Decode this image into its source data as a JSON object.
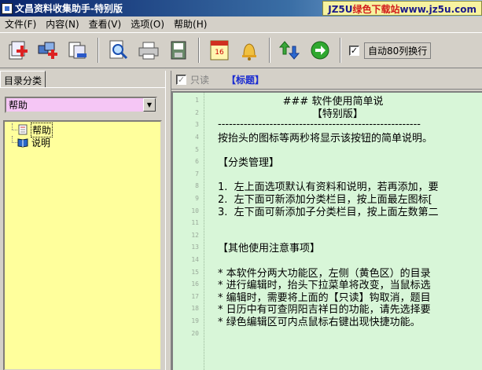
{
  "window": {
    "title": "文昌资料收集助手-特别版"
  },
  "watermark": {
    "prefix": "JZ5U",
    "accent": "绿色下载站",
    "suffix": "www.jz5u.com"
  },
  "menu": [
    "文件(F)",
    "内容(N)",
    "查看(V)",
    "选项(O)",
    "帮助(H)"
  ],
  "toolbar": {
    "buttons": [
      {
        "name": "add-category-button",
        "icon": "add-category-icon"
      },
      {
        "name": "add-subcategory-button",
        "icon": "add-subcategory-icon"
      },
      {
        "name": "delete-category-button",
        "icon": "delete-category-icon"
      },
      {
        "name": "search-button",
        "icon": "search-icon"
      },
      {
        "name": "print-button",
        "icon": "printer-icon"
      },
      {
        "name": "save-button",
        "icon": "save-icon"
      },
      {
        "name": "calendar-button",
        "icon": "calendar-icon",
        "text": "16"
      },
      {
        "name": "bell-button",
        "icon": "bell-icon"
      },
      {
        "name": "up-down-button",
        "icon": "up-down-arrows-icon"
      },
      {
        "name": "go-button",
        "icon": "go-arrow-icon"
      }
    ],
    "wrap_label": "自动80列换行",
    "wrap_checked": true
  },
  "left": {
    "tab_label": "目录分类",
    "combo_value": "帮助",
    "tree": [
      {
        "label": "帮助",
        "icon": "document-icon",
        "selected": true
      },
      {
        "label": "说明",
        "icon": "book-icon",
        "selected": false
      }
    ]
  },
  "right": {
    "readonly_label": "只读",
    "readonly_checked": true,
    "title_field": "【标题】"
  },
  "editor": {
    "lines": [
      {
        "n": "1",
        "text": "                    ### 软件使用简单说"
      },
      {
        "n": "2",
        "text": "                             【特别版】"
      },
      {
        "n": "3",
        "text": "-------------------------------------------------------"
      },
      {
        "n": "4",
        "text": "按抬头的图标等两秒将显示该按钮的简单说明。"
      },
      {
        "n": "5",
        "text": ""
      },
      {
        "n": "6",
        "text": "【分类管理】"
      },
      {
        "n": "7",
        "text": ""
      },
      {
        "n": "8",
        "text": "1.  左上面选项默认有资料和说明，若再添加，要"
      },
      {
        "n": "9",
        "text": "2.  左下面可新添加分类栏目，按上面最左图标["
      },
      {
        "n": "10",
        "text": "3.  左下面可新添加子分类栏目，按上面左数第二"
      },
      {
        "n": "11",
        "text": ""
      },
      {
        "n": "12",
        "text": ""
      },
      {
        "n": "13",
        "text": "【其他使用注意事项】"
      },
      {
        "n": "14",
        "text": ""
      },
      {
        "n": "15",
        "text": "* 本软件分两大功能区，左侧（黄色区）的目录"
      },
      {
        "n": "16",
        "text": "* 进行编辑时，抬头下拉菜单将改变，当鼠标选"
      },
      {
        "n": "17",
        "text": "* 编辑时，需要将上面的【只读】钩取消，题目"
      },
      {
        "n": "18",
        "text": "* 日历中有可查阴阳吉祥日的功能，请先选择要"
      },
      {
        "n": "19",
        "text": "* 绿色编辑区可内点鼠标右键出现快捷功能。"
      },
      {
        "n": "20",
        "text": ""
      }
    ]
  }
}
